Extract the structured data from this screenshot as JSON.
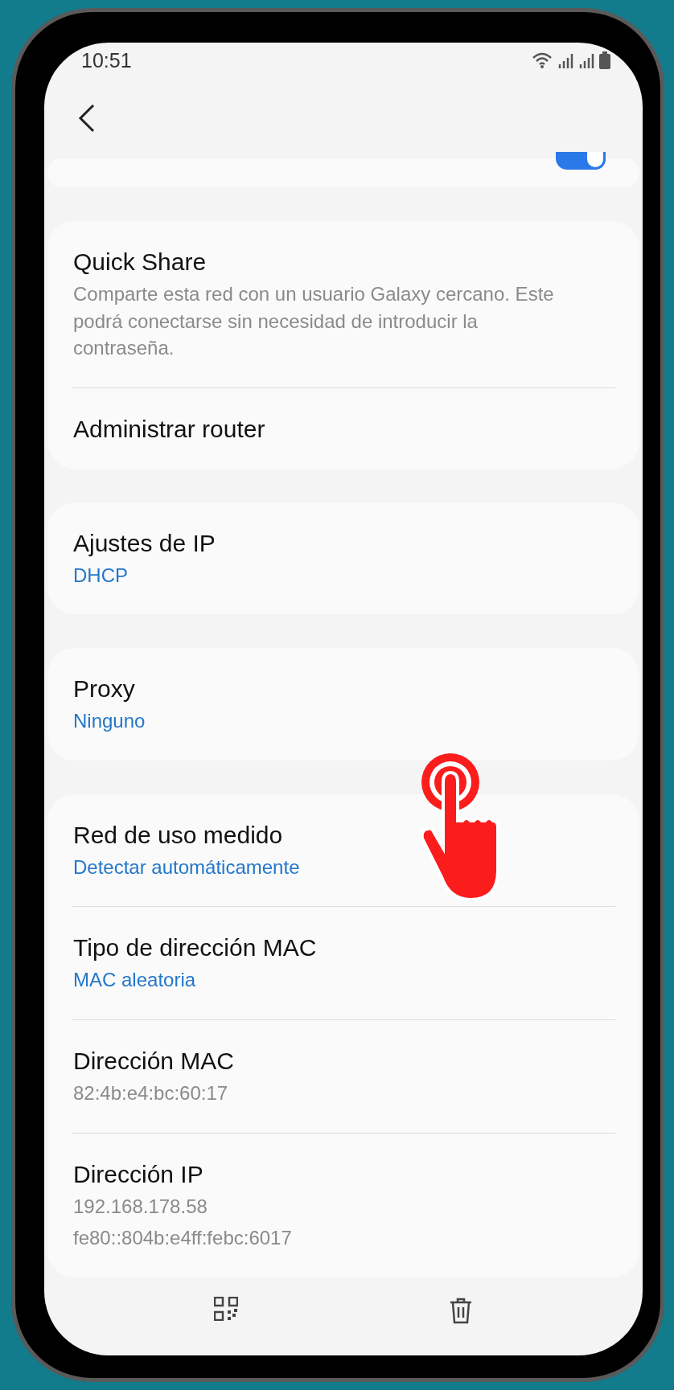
{
  "status_bar": {
    "time": "10:51"
  },
  "auto_reconnect": {
    "on": true
  },
  "groups": [
    {
      "items": [
        {
          "title": "Quick Share",
          "kind": "description",
          "lines": [
            "Comparte esta red con un usuario Galaxy cercano. Este podrá conectarse sin necesidad de introducir la contraseña."
          ]
        },
        {
          "title": "Administrar router"
        }
      ]
    },
    {
      "items": [
        {
          "title": "Ajustes de IP",
          "kind": "value",
          "lines": [
            "DHCP"
          ]
        }
      ]
    },
    {
      "items": [
        {
          "title": "Proxy",
          "kind": "value",
          "lines": [
            "Ninguno"
          ]
        }
      ]
    },
    {
      "items": [
        {
          "title": "Red de uso medido",
          "kind": "value",
          "lines": [
            "Detectar automáticamente"
          ]
        },
        {
          "title": "Tipo de dirección MAC",
          "kind": "value",
          "lines": [
            "MAC aleatoria"
          ]
        },
        {
          "title": "Dirección MAC",
          "kind": "info",
          "lines": [
            "82:4b:e4:bc:60:17"
          ]
        },
        {
          "title": "Dirección IP",
          "kind": "info",
          "lines": [
            "192.168.178.58",
            "fe80::804b:e4ff:febc:6017"
          ]
        }
      ]
    }
  ]
}
